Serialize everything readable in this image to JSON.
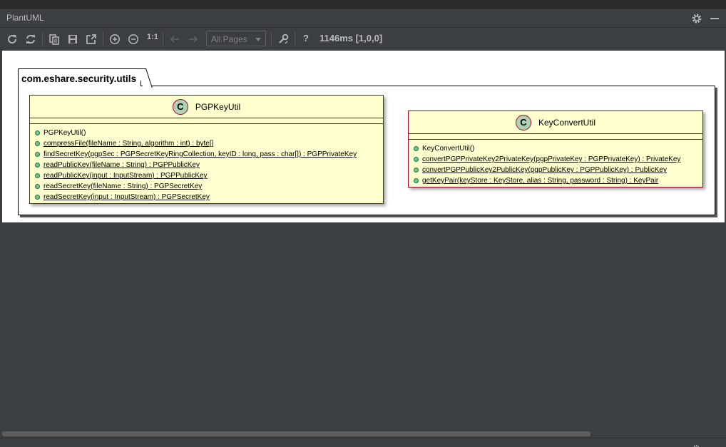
{
  "window": {
    "title": "PlantUML"
  },
  "toolbar": {
    "zoom_reset_label": "1:1",
    "page_select": "All Pages",
    "help_label": "?",
    "timing": "1146ms [1,0,0]"
  },
  "diagram": {
    "package": "com.eshare.security.utils",
    "classes": [
      {
        "name": "PGPKeyUtil",
        "badge": "C",
        "methods": [
          {
            "text": "PGPKeyUtil()",
            "static": false
          },
          {
            "text": "compressFile(fileName : String, algorithm : int) : byte[]",
            "static": true
          },
          {
            "text": "findSecretKey(pgpSec : PGPSecretKeyRingCollection, keyID : long, pass : char[]) : PGPPrivateKey",
            "static": true
          },
          {
            "text": "readPublicKey(fileName : String) : PGPPublicKey",
            "static": true
          },
          {
            "text": "readPublicKey(input : InputStream) : PGPPublicKey",
            "static": true
          },
          {
            "text": "readSecretKey(fileName : String) : PGPSecretKey",
            "static": true
          },
          {
            "text": "readSecretKey(input : InputStream) : PGPSecretKey",
            "static": true
          }
        ]
      },
      {
        "name": "KeyConvertUtil",
        "badge": "C",
        "methods": [
          {
            "text": "KeyConvertUtil()",
            "static": false
          },
          {
            "text": "convertPGPPrivateKey2PrivateKey(pgpPrivateKey : PGPPrivateKey) : PrivateKey",
            "static": true
          },
          {
            "text": "convertPGPPublicKey2PublicKey(pgpPublicKey : PGPPublicKey) : PublicKey",
            "static": true
          },
          {
            "text": "getKeyPair(keyStore : KeyStore, alias : String, password : String) : KeyPair",
            "static": true
          }
        ]
      }
    ]
  },
  "colors": {
    "class_fill": "#fefece",
    "class_border": "#a80036",
    "badge_fill": "#add1b2",
    "method_dot": "#84be84"
  }
}
